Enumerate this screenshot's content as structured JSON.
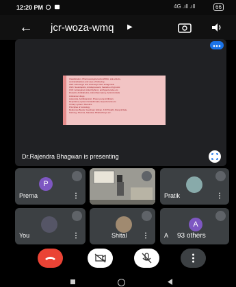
{
  "status": {
    "time": "12:20 PM",
    "signal": "4G .ıll .ıll",
    "battery": "66"
  },
  "header": {
    "meeting_code": "jcr-woza-wmq"
  },
  "presentation": {
    "presenter_label": "Dr.Rajendra Bhagwan is presenting",
    "slide_lines": [
      "Classification, Pharmacological action/MOA, side effects,",
      "contraindications and uses of following",
      "ANS: Adrenergic and cholinergic their antagonists",
      "CNS: Neuroleptics, Antidepressant, Sedative & hypnotic",
      "CVS: Antianginal, Antiarrhythmic, antihypertensive etc.",
      "Diuretics Antidiabetics, Anti-inflammatory, Antimicrobials",
      "Anticancer drugs",
      "Autocoids, Antihistaminic, Proton pump inhibitors",
      "Respiratory system:Antiasthmatic, Expectorants etc.",
      "Urinary system: Diuretics",
      "Principles of toxicology",
      "Reference Books: Goodman Gilman, K.D.Tripathi, Rang & Dale,",
      "Katzung, Sharma, Satoskar, Bhattacharya etc."
    ]
  },
  "participants": [
    {
      "name": "Prerna",
      "avatar_letter": "P",
      "avatar_color": "#7e57c2"
    },
    {
      "name": "",
      "avatar_letter": ""
    },
    {
      "name": "Pratik",
      "avatar_letter": ""
    },
    {
      "name": "You",
      "avatar_letter": ""
    },
    {
      "name": "Shital",
      "avatar_letter": ""
    },
    {
      "name": "A",
      "avatar_letter": "A",
      "avatar_color": "#7e57c2",
      "others": "93 others"
    }
  ],
  "colors": {
    "hangup": "#ea4335",
    "tile": "#3c4043",
    "accent": "#1a73e8"
  }
}
